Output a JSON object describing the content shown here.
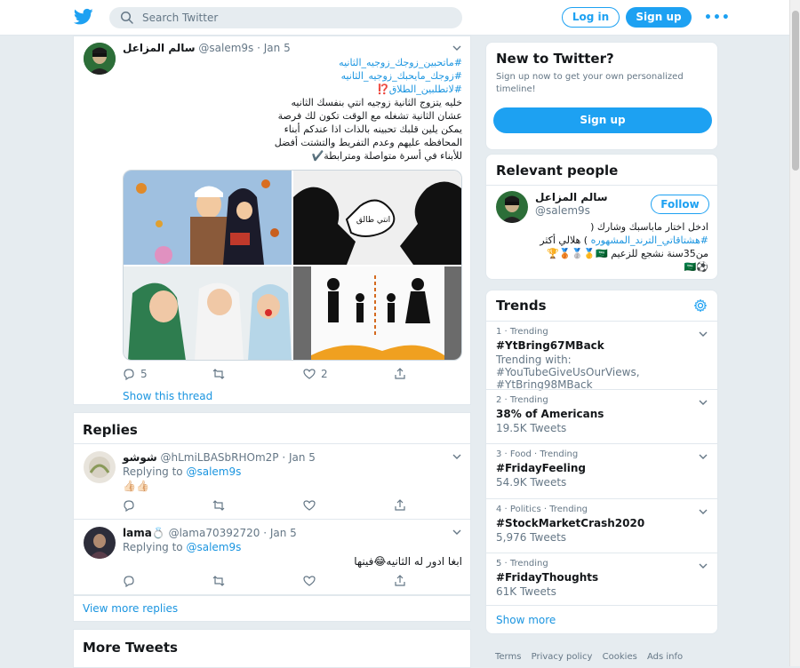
{
  "header": {
    "search_placeholder": "Search Twitter",
    "login_label": "Log in",
    "signup_label": "Sign up",
    "more_label": "•••"
  },
  "tweet": {
    "name": "سالم المزاعل",
    "handle": "@salem9s",
    "date": "· Jan 5",
    "hashtags": [
      "#ماتحبين_زوجك_زوجيه_الثانيه",
      "#زوجك_مايحبك_زوجيه_الثانيه",
      "#لاتطلبين_الطلاق⁉️"
    ],
    "body": [
      "خليه يتزوج الثانية زوجيه انتي بنفسك الثانيه",
      "عشان الثانية تشغله مع الوقت تكون لك فرصة",
      "يمكن يلين قلبك تحبينه بالذات اذا عندكم أبناء",
      "المحافظه عليهم وعدم التفريط والتشتت أفضل",
      "للأبناء في أسرة متواصلة ومترابطة✔️"
    ],
    "media_label": "انتي طالق",
    "reply_count": "5",
    "retweet_count": "",
    "like_count": "2",
    "show_thread": "Show this thread"
  },
  "replies_title": "Replies",
  "replies": [
    {
      "name": "شوشو",
      "handle": "@hLmiLBASbRHOm2P",
      "date": "· Jan 5",
      "replying_prefix": "Replying to",
      "replying_to": "@salem9s",
      "body": "👍🏻👍🏻"
    },
    {
      "name": "lama💍",
      "handle": "@lama70392720",
      "date": "· Jan 5",
      "replying_prefix": "Replying to",
      "replying_to": "@salem9s",
      "body": "ابغا ادور  له الثانيه😂فينها"
    }
  ],
  "view_more_replies": "View more replies",
  "more_tweets_title": "More Tweets",
  "sidebar": {
    "new_title": "New to Twitter?",
    "new_desc": "Sign up now to get your own personalized timeline!",
    "new_signup": "Sign up",
    "relevant_title": "Relevant people",
    "person": {
      "name": "سالم المزاعل",
      "handle": "@salem9s",
      "follow": "Follow",
      "bio_1": "ادخل اختار ماباسبك وشارك (",
      "bio_tag": "#هشتاقاتي_الترند_المشهوره",
      "bio_2": ") هلالي أكثر",
      "bio_3": "من35سنة نشجع للزعيم 🇸🇦🥇🥈🥉🏆",
      "bio_4": "⚽🇸🇦"
    },
    "trends_title": "Trends",
    "trends": [
      {
        "meta": "1 · Trending",
        "title": "#YtBring67MBack",
        "sub": "Trending with: #YouTubeGiveUsOurViews, #YtBring98MBack"
      },
      {
        "meta": "2 · Trending",
        "title": "38% of Americans",
        "sub": "19.5K Tweets"
      },
      {
        "meta": "3 · Food · Trending",
        "title": "#FridayFeeling",
        "sub": "54.9K Tweets"
      },
      {
        "meta": "4 · Politics · Trending",
        "title": "#StockMarketCrash2020",
        "sub": "5,976 Tweets"
      },
      {
        "meta": "5 · Trending",
        "title": "#FridayThoughts",
        "sub": "61K Tweets"
      }
    ],
    "show_more": "Show more",
    "footer": [
      "Terms",
      "Privacy policy",
      "Cookies",
      "Ads info"
    ]
  },
  "colors": {
    "accent": "#1da1f2",
    "link": "#1b95e0",
    "background": "#e6ecf0",
    "muted": "#657786"
  }
}
